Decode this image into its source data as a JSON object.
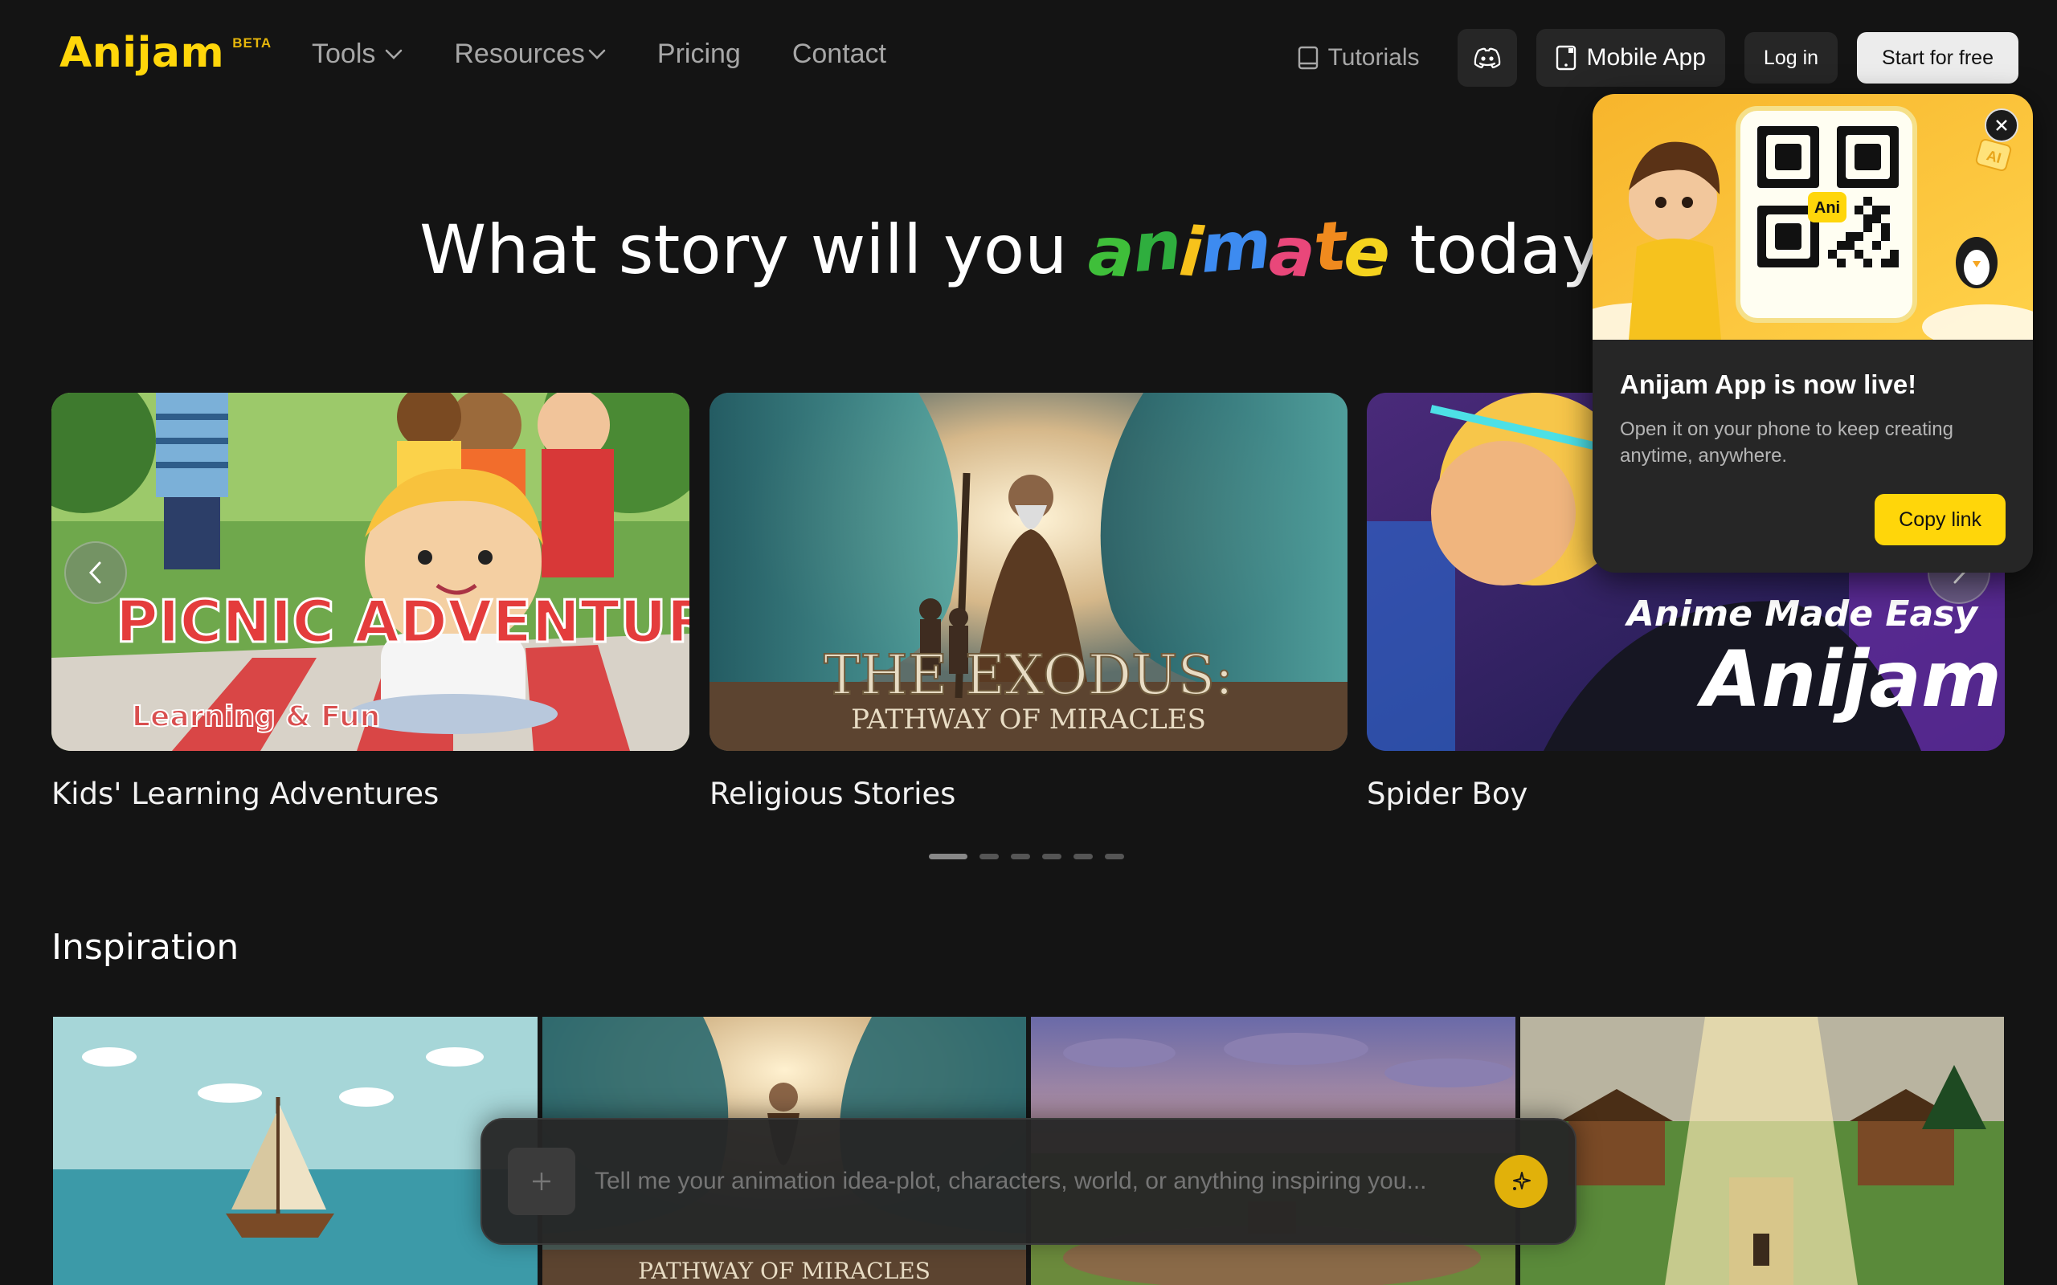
{
  "brand": {
    "name": "Anijam",
    "badge": "BETA"
  },
  "nav": {
    "items": [
      {
        "label": "Tools",
        "dropdown": true
      },
      {
        "label": "Resources",
        "dropdown": true
      },
      {
        "label": "Pricing",
        "dropdown": false
      },
      {
        "label": "Contact",
        "dropdown": false
      }
    ]
  },
  "header_actions": {
    "tutorials": "Tutorials",
    "discord_icon": "discord-icon",
    "mobile_app": "Mobile App",
    "login": "Log in",
    "start": "Start for free"
  },
  "hero": {
    "title_before": "What story will you",
    "title_highlight": "animate",
    "title_after": "today?"
  },
  "carousel": {
    "cards": [
      {
        "label": "Kids' Learning Adventures",
        "overlay_title": "PICNIC ADVENTURES!",
        "overlay_subtitle": "Learning & Fun"
      },
      {
        "label": "Religious Stories",
        "overlay_title": "THE EXODUS:",
        "overlay_subtitle": "PATHWAY OF MIRACLES"
      },
      {
        "label": "Spider Boy",
        "overlay_title": "Anime Made Easy",
        "overlay_subtitle": "Anijam"
      }
    ],
    "active_page": 1,
    "page_count": 6
  },
  "inspiration": {
    "heading": "Inspiration",
    "tiles": [
      {
        "scene": "sailboat-ocean"
      },
      {
        "scene": "exodus",
        "caption": "PATHWAY OF MIRACLES"
      },
      {
        "scene": "clay-landscape"
      },
      {
        "scene": "block-village"
      }
    ]
  },
  "prompt": {
    "placeholder": "Tell me your animation idea-plot, characters, world, or anything inspiring you..."
  },
  "popup": {
    "title": "Anijam App is now live!",
    "description": "Open it on your phone to keep creating anytime, anywhere.",
    "copy_button": "Copy link",
    "qr_label": "Ani",
    "badge": "AI"
  },
  "colors": {
    "accent": "#FFD60A",
    "background": "#141414",
    "surface": "#262626"
  }
}
